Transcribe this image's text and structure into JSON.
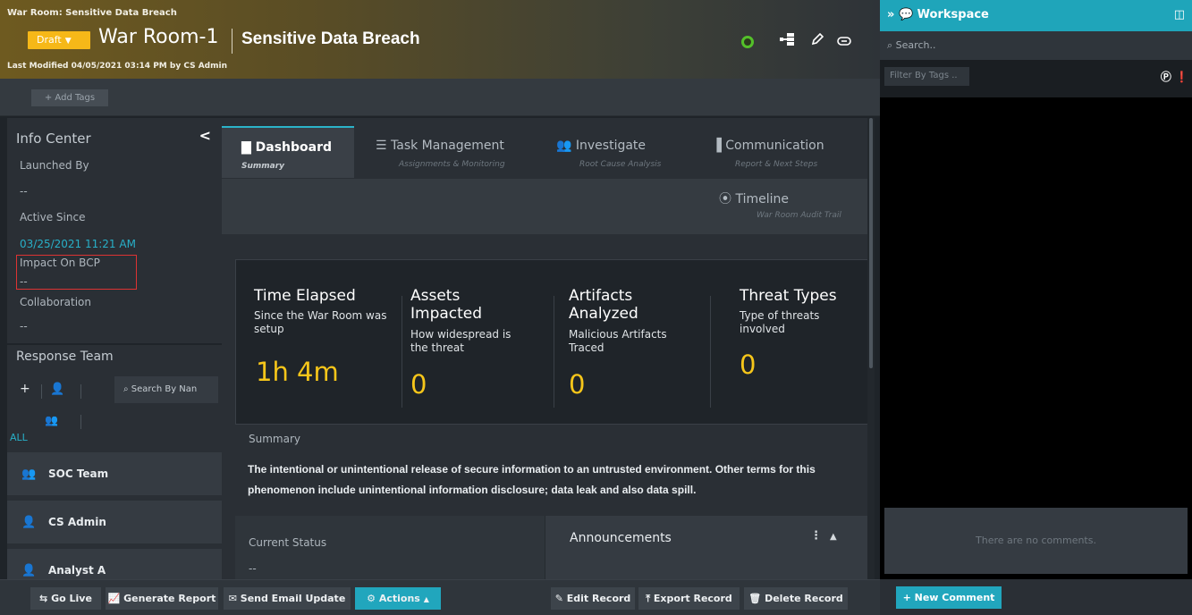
{
  "header": {
    "breadcrumb": "War Room: Sensitive Data Breach",
    "status": "Draft",
    "title": "War Room-1",
    "subtitle": "Sensitive Data Breach",
    "modified": "Last Modified 04/05/2021 03:14 PM by CS Admin",
    "icons": [
      "live-indicator",
      "hierarchy-icon",
      "pencil-icon",
      "link-icon"
    ]
  },
  "tags": {
    "add_label": "+ Add Tags"
  },
  "info": {
    "title": "Info Center",
    "launched_label": "Launched By",
    "launched_value": "--",
    "active_label": "Active Since",
    "active_value": "03/25/2021 11:21 AM",
    "bcp_label": "Impact On BCP",
    "bcp_value": "--",
    "collab_label": "Collaboration",
    "collab_value": "--",
    "team_title": "Response Team",
    "search_placeholder": "Search By Nan",
    "all_label": "ALL",
    "members": [
      {
        "name": "SOC Team"
      },
      {
        "name": "CS Admin"
      },
      {
        "name": "Analyst A"
      }
    ]
  },
  "tabs": [
    {
      "title": "Dashboard",
      "sub": "Summary"
    },
    {
      "title": "Task Management",
      "sub": "Assignments & Monitoring"
    },
    {
      "title": "Investigate",
      "sub": "Root Cause Analysis"
    },
    {
      "title": "Communication",
      "sub": "Report & Next Steps"
    },
    {
      "title": "Timeline",
      "sub": "War Room Audit Trail"
    }
  ],
  "stats": [
    {
      "title": "Time Elapsed",
      "desc": "Since the War Room was setup",
      "value": "1h 4m"
    },
    {
      "title": "Assets Impacted",
      "desc": "How widespread is the threat",
      "value": "0"
    },
    {
      "title": "Artifacts Analyzed",
      "desc": "Malicious Artifacts Traced",
      "value": "0"
    },
    {
      "title": "Threat Types",
      "desc": "Type of threats involved",
      "value": "0"
    }
  ],
  "summary": {
    "label": "Summary",
    "text": "The intentional or unintentional release of secure information to an untrusted environment. Other terms for this phenomenon include unintentional information disclosure; data leak and also data spill."
  },
  "status": {
    "label": "Current Status",
    "value": "--"
  },
  "announcements": {
    "title": "Announcements"
  },
  "toolbar": {
    "go_live": "Go Live",
    "generate_report": "Generate Report",
    "send_email": "Send Email Update",
    "actions": "Actions",
    "edit": "Edit Record",
    "export": "Export Record",
    "delete": "Delete Record"
  },
  "workspace": {
    "title": "Workspace",
    "search_placeholder": "Search..",
    "filter_placeholder": "Filter By Tags ..",
    "empty_comments": "There are no comments.",
    "new_comment": "+ New Comment"
  },
  "colors": {
    "accent": "#21a6bd",
    "draft": "#f6b818",
    "stat_value": "#f6c61a"
  }
}
